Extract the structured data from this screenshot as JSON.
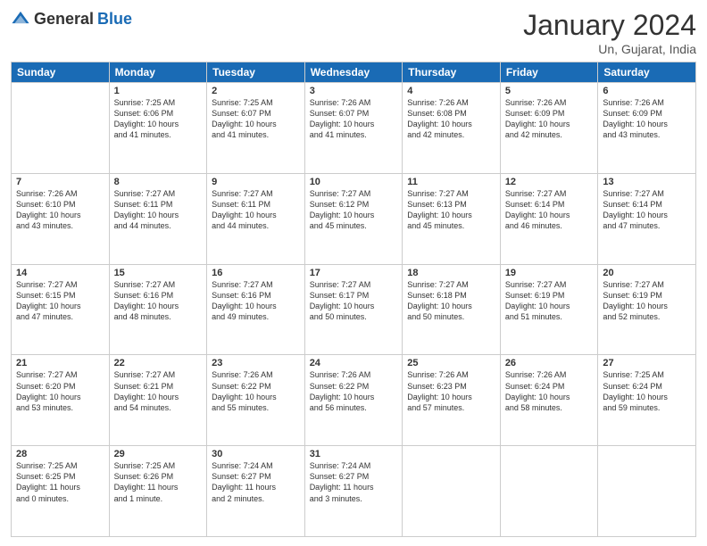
{
  "logo": {
    "general": "General",
    "blue": "Blue"
  },
  "header": {
    "month": "January 2024",
    "location": "Un, Gujarat, India"
  },
  "weekdays": [
    "Sunday",
    "Monday",
    "Tuesday",
    "Wednesday",
    "Thursday",
    "Friday",
    "Saturday"
  ],
  "weeks": [
    [
      {
        "day": "",
        "info": ""
      },
      {
        "day": "1",
        "info": "Sunrise: 7:25 AM\nSunset: 6:06 PM\nDaylight: 10 hours\nand 41 minutes."
      },
      {
        "day": "2",
        "info": "Sunrise: 7:25 AM\nSunset: 6:07 PM\nDaylight: 10 hours\nand 41 minutes."
      },
      {
        "day": "3",
        "info": "Sunrise: 7:26 AM\nSunset: 6:07 PM\nDaylight: 10 hours\nand 41 minutes."
      },
      {
        "day": "4",
        "info": "Sunrise: 7:26 AM\nSunset: 6:08 PM\nDaylight: 10 hours\nand 42 minutes."
      },
      {
        "day": "5",
        "info": "Sunrise: 7:26 AM\nSunset: 6:09 PM\nDaylight: 10 hours\nand 42 minutes."
      },
      {
        "day": "6",
        "info": "Sunrise: 7:26 AM\nSunset: 6:09 PM\nDaylight: 10 hours\nand 43 minutes."
      }
    ],
    [
      {
        "day": "7",
        "info": "Sunrise: 7:26 AM\nSunset: 6:10 PM\nDaylight: 10 hours\nand 43 minutes."
      },
      {
        "day": "8",
        "info": "Sunrise: 7:27 AM\nSunset: 6:11 PM\nDaylight: 10 hours\nand 44 minutes."
      },
      {
        "day": "9",
        "info": "Sunrise: 7:27 AM\nSunset: 6:11 PM\nDaylight: 10 hours\nand 44 minutes."
      },
      {
        "day": "10",
        "info": "Sunrise: 7:27 AM\nSunset: 6:12 PM\nDaylight: 10 hours\nand 45 minutes."
      },
      {
        "day": "11",
        "info": "Sunrise: 7:27 AM\nSunset: 6:13 PM\nDaylight: 10 hours\nand 45 minutes."
      },
      {
        "day": "12",
        "info": "Sunrise: 7:27 AM\nSunset: 6:14 PM\nDaylight: 10 hours\nand 46 minutes."
      },
      {
        "day": "13",
        "info": "Sunrise: 7:27 AM\nSunset: 6:14 PM\nDaylight: 10 hours\nand 47 minutes."
      }
    ],
    [
      {
        "day": "14",
        "info": "Sunrise: 7:27 AM\nSunset: 6:15 PM\nDaylight: 10 hours\nand 47 minutes."
      },
      {
        "day": "15",
        "info": "Sunrise: 7:27 AM\nSunset: 6:16 PM\nDaylight: 10 hours\nand 48 minutes."
      },
      {
        "day": "16",
        "info": "Sunrise: 7:27 AM\nSunset: 6:16 PM\nDaylight: 10 hours\nand 49 minutes."
      },
      {
        "day": "17",
        "info": "Sunrise: 7:27 AM\nSunset: 6:17 PM\nDaylight: 10 hours\nand 50 minutes."
      },
      {
        "day": "18",
        "info": "Sunrise: 7:27 AM\nSunset: 6:18 PM\nDaylight: 10 hours\nand 50 minutes."
      },
      {
        "day": "19",
        "info": "Sunrise: 7:27 AM\nSunset: 6:19 PM\nDaylight: 10 hours\nand 51 minutes."
      },
      {
        "day": "20",
        "info": "Sunrise: 7:27 AM\nSunset: 6:19 PM\nDaylight: 10 hours\nand 52 minutes."
      }
    ],
    [
      {
        "day": "21",
        "info": "Sunrise: 7:27 AM\nSunset: 6:20 PM\nDaylight: 10 hours\nand 53 minutes."
      },
      {
        "day": "22",
        "info": "Sunrise: 7:27 AM\nSunset: 6:21 PM\nDaylight: 10 hours\nand 54 minutes."
      },
      {
        "day": "23",
        "info": "Sunrise: 7:26 AM\nSunset: 6:22 PM\nDaylight: 10 hours\nand 55 minutes."
      },
      {
        "day": "24",
        "info": "Sunrise: 7:26 AM\nSunset: 6:22 PM\nDaylight: 10 hours\nand 56 minutes."
      },
      {
        "day": "25",
        "info": "Sunrise: 7:26 AM\nSunset: 6:23 PM\nDaylight: 10 hours\nand 57 minutes."
      },
      {
        "day": "26",
        "info": "Sunrise: 7:26 AM\nSunset: 6:24 PM\nDaylight: 10 hours\nand 58 minutes."
      },
      {
        "day": "27",
        "info": "Sunrise: 7:25 AM\nSunset: 6:24 PM\nDaylight: 10 hours\nand 59 minutes."
      }
    ],
    [
      {
        "day": "28",
        "info": "Sunrise: 7:25 AM\nSunset: 6:25 PM\nDaylight: 11 hours\nand 0 minutes."
      },
      {
        "day": "29",
        "info": "Sunrise: 7:25 AM\nSunset: 6:26 PM\nDaylight: 11 hours\nand 1 minute."
      },
      {
        "day": "30",
        "info": "Sunrise: 7:24 AM\nSunset: 6:27 PM\nDaylight: 11 hours\nand 2 minutes."
      },
      {
        "day": "31",
        "info": "Sunrise: 7:24 AM\nSunset: 6:27 PM\nDaylight: 11 hours\nand 3 minutes."
      },
      {
        "day": "",
        "info": ""
      },
      {
        "day": "",
        "info": ""
      },
      {
        "day": "",
        "info": ""
      }
    ]
  ]
}
